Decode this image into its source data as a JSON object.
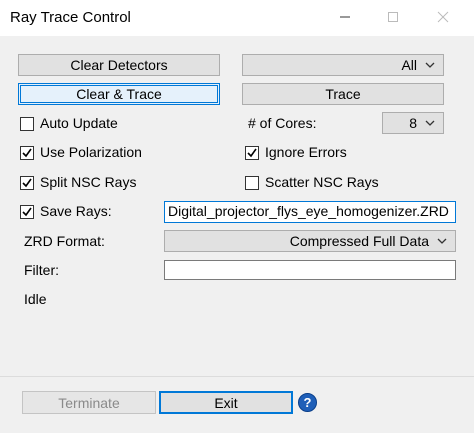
{
  "window": {
    "title": "Ray Trace Control"
  },
  "buttons": {
    "clear_detectors": "Clear Detectors",
    "clear_trace": "Clear & Trace",
    "trace": "Trace",
    "terminate": "Terminate",
    "exit": "Exit"
  },
  "combos": {
    "detectors_selection": "All",
    "cores": "8",
    "zrd_format": "Compressed Full Data"
  },
  "checkboxes": {
    "auto_update": {
      "label": "Auto Update",
      "checked": false
    },
    "use_polarization": {
      "label": "Use Polarization",
      "checked": true
    },
    "ignore_errors": {
      "label": "Ignore Errors",
      "checked": true
    },
    "split_nsc_rays": {
      "label": "Split NSC Rays",
      "checked": true
    },
    "scatter_nsc_rays": {
      "label": "Scatter NSC Rays",
      "checked": false
    },
    "save_rays": {
      "label": "Save Rays:",
      "checked": true
    }
  },
  "labels": {
    "cores": "# of Cores:",
    "zrd_format": "ZRD Format:",
    "filter": "Filter:",
    "status": "Idle"
  },
  "fields": {
    "save_rays_file": "Digital_projector_flys_eye_homogenizer.ZRD",
    "filter": ""
  }
}
